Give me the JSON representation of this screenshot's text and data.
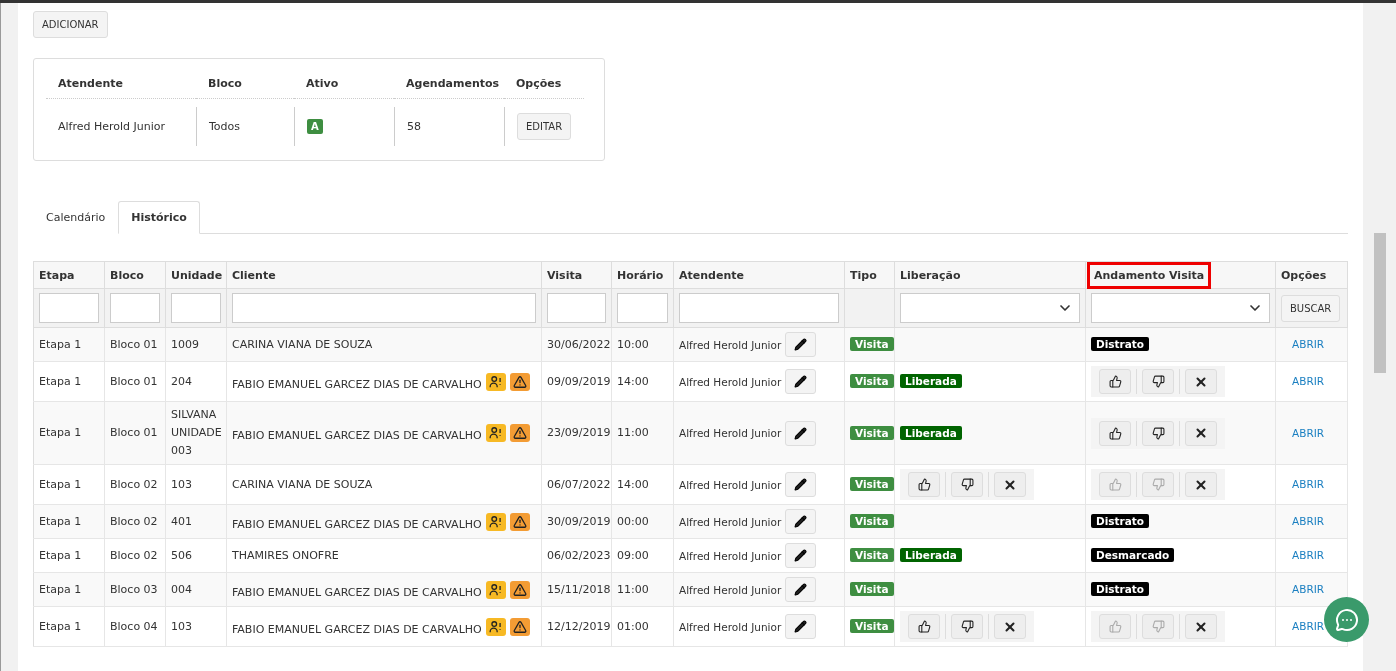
{
  "add_button": "ADICIONAR",
  "summary": {
    "columns": [
      "Atendente",
      "Bloco",
      "Ativo",
      "Agendamentos",
      "Opções"
    ],
    "row": {
      "atendente": "Alfred Herold Junior",
      "bloco": "Todos",
      "ativo": "A",
      "agendamentos": "58",
      "button": "EDITAR"
    }
  },
  "tabs": [
    {
      "label": "Calendário",
      "selected": false
    },
    {
      "label": "Histórico",
      "selected": true
    }
  ],
  "table": {
    "columns": [
      {
        "label": "Etapa",
        "highlighted": false
      },
      {
        "label": "Bloco",
        "highlighted": false
      },
      {
        "label": "Unidade",
        "highlighted": false
      },
      {
        "label": "Cliente",
        "highlighted": false
      },
      {
        "label": "Visita",
        "highlighted": false
      },
      {
        "label": "Horário",
        "highlighted": false
      },
      {
        "label": "Atendente",
        "highlighted": false
      },
      {
        "label": "Tipo",
        "highlighted": false
      },
      {
        "label": "Liberação",
        "highlighted": false
      },
      {
        "label": "Andamento Visita",
        "highlighted": true
      },
      {
        "label": "Opções",
        "highlighted": false
      }
    ],
    "filters": [
      {
        "kind": "input"
      },
      {
        "kind": "input"
      },
      {
        "kind": "input"
      },
      {
        "kind": "input"
      },
      {
        "kind": "input"
      },
      {
        "kind": "input"
      },
      {
        "kind": "input"
      },
      {
        "kind": "none"
      },
      {
        "kind": "select"
      },
      {
        "kind": "select"
      },
      {
        "kind": "button",
        "label": "BUSCAR"
      }
    ],
    "rows": [
      {
        "etapa": "Etapa 1",
        "bloco": "Bloco 01",
        "unidade": "1009",
        "cliente": "CARINA VIANA DE SOUZA",
        "alerts": false,
        "visita": "30/06/2022",
        "horario": "10:00",
        "atendente": "Alfred Herold Junior",
        "tipo": "Visita",
        "liberacao": {
          "kind": "none"
        },
        "andamento": {
          "kind": "badge",
          "text": "Distrato"
        },
        "action": "ABRIR"
      },
      {
        "etapa": "Etapa 1",
        "bloco": "Bloco 01",
        "unidade": "204",
        "cliente": "FABIO EMANUEL GARCEZ DIAS DE CARVALHO",
        "alerts": true,
        "visita": "09/09/2019",
        "horario": "14:00",
        "atendente": "Alfred Herold Junior",
        "tipo": "Visita",
        "liberacao": {
          "kind": "badge",
          "text": "Liberada"
        },
        "andamento": {
          "kind": "buttons",
          "disabled": false
        },
        "action": "ABRIR"
      },
      {
        "etapa": "Etapa 1",
        "bloco": "Bloco 01",
        "unidade": "SILVANA UNIDADE 003",
        "cliente": "FABIO EMANUEL GARCEZ DIAS DE CARVALHO",
        "alerts": true,
        "visita": "23/09/2019",
        "horario": "11:00",
        "atendente": "Alfred Herold Junior",
        "tipo": "Visita",
        "liberacao": {
          "kind": "badge",
          "text": "Liberada"
        },
        "andamento": {
          "kind": "buttons",
          "disabled": false
        },
        "action": "ABRIR"
      },
      {
        "etapa": "Etapa 1",
        "bloco": "Bloco 02",
        "unidade": "103",
        "cliente": "CARINA VIANA DE SOUZA",
        "alerts": false,
        "visita": "06/07/2022",
        "horario": "14:00",
        "atendente": "Alfred Herold Junior",
        "tipo": "Visita",
        "liberacao": {
          "kind": "buttons",
          "disabled": false
        },
        "andamento": {
          "kind": "buttons",
          "disabled": true
        },
        "action": "ABRIR"
      },
      {
        "etapa": "Etapa 1",
        "bloco": "Bloco 02",
        "unidade": "401",
        "cliente": "FABIO EMANUEL GARCEZ DIAS DE CARVALHO",
        "alerts": true,
        "visita": "30/09/2019",
        "horario": "00:00",
        "atendente": "Alfred Herold Junior",
        "tipo": "Visita",
        "liberacao": {
          "kind": "none"
        },
        "andamento": {
          "kind": "badge",
          "text": "Distrato"
        },
        "action": "ABRIR"
      },
      {
        "etapa": "Etapa 1",
        "bloco": "Bloco 02",
        "unidade": "506",
        "cliente": "THAMIRES ONOFRE",
        "alerts": false,
        "visita": "06/02/2023",
        "horario": "09:00",
        "atendente": "Alfred Herold Junior",
        "tipo": "Visita",
        "liberacao": {
          "kind": "badge",
          "text": "Liberada"
        },
        "andamento": {
          "kind": "badge",
          "text": "Desmarcado"
        },
        "action": "ABRIR"
      },
      {
        "etapa": "Etapa 1",
        "bloco": "Bloco 03",
        "unidade": "004",
        "cliente": "FABIO EMANUEL GARCEZ DIAS DE CARVALHO",
        "alerts": true,
        "visita": "15/11/2018",
        "horario": "11:00",
        "atendente": "Alfred Herold Junior",
        "tipo": "Visita",
        "liberacao": {
          "kind": "none"
        },
        "andamento": {
          "kind": "badge",
          "text": "Distrato"
        },
        "action": "ABRIR"
      },
      {
        "etapa": "Etapa 1",
        "bloco": "Bloco 04",
        "unidade": "103",
        "cliente": "FABIO EMANUEL GARCEZ DIAS DE CARVALHO",
        "alerts": true,
        "visita": "12/12/2019",
        "horario": "01:00",
        "atendente": "Alfred Herold Junior",
        "tipo": "Visita",
        "liberacao": {
          "kind": "buttons",
          "disabled": false
        },
        "andamento": {
          "kind": "buttons",
          "disabled": true
        },
        "action": "ABRIR"
      }
    ]
  }
}
